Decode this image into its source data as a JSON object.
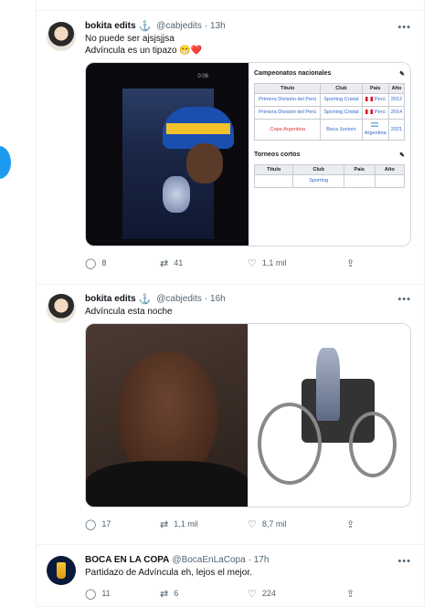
{
  "tweets": [
    {
      "name": "bokita edits",
      "anchor": "⚓",
      "handle": "@cabjedits",
      "time": "· 13h",
      "text_lines": [
        "No puede ser ajsjsjjsa",
        "Advíncula es un tipazo 😁❤️"
      ],
      "media": {
        "video_time": "0:06",
        "table_title": "Campeonatos nacionales",
        "table_headers": [
          "Título",
          "Club",
          "País",
          "Año"
        ],
        "table_rows": [
          [
            "Primera División del Perú",
            "Sporting Cristal",
            "Perú",
            "2012"
          ],
          [
            "Primera División del Perú",
            "Sporting Cristal",
            "Perú",
            "2014"
          ],
          [
            "Copa Argentina",
            "Boca Juniors",
            "Argentina",
            "2021"
          ]
        ],
        "table2_title": "Torneos cortos",
        "table2_headers": [
          "Título",
          "Club",
          "País",
          "Año"
        ],
        "table2_partial": "Sporting"
      },
      "actions": {
        "replies": "8",
        "retweets": "41",
        "likes": "1,1 mil"
      }
    },
    {
      "name": "bokita edits",
      "anchor": "⚓",
      "handle": "@cabjedits",
      "time": "· 16h",
      "text_lines": [
        "Advíncula esta noche"
      ],
      "actions": {
        "replies": "17",
        "retweets": "1,1 mil",
        "likes": "8,7 mil"
      }
    },
    {
      "name": "BOCA EN LA COPA",
      "handle": "@BocaEnLaCopa",
      "time": "· 17h",
      "text_lines": [
        "Partidazo de Advíncula eh, lejos el mejor."
      ],
      "actions": {
        "replies": "11",
        "retweets": "6",
        "likes": "224"
      }
    }
  ],
  "icons": {
    "reply": "reply-icon",
    "retweet": "retweet-icon",
    "like": "heart-icon",
    "share": "share-icon",
    "more": "more-icon"
  },
  "colors": {
    "accent": "#1d9bf0",
    "secondary_text": "#536471"
  }
}
